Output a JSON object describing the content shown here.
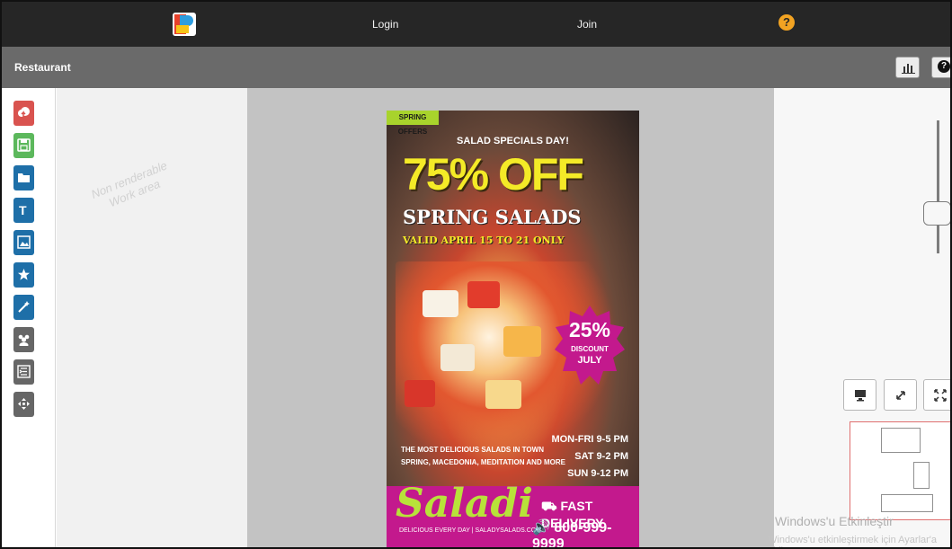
{
  "topbar": {
    "nav": [
      "Login",
      "Join"
    ],
    "help_icon": "?"
  },
  "titlebar": {
    "title": "Restaurant",
    "help_label": "?"
  },
  "lefttools": [
    {
      "name": "upload-icon",
      "color": "#d9534f"
    },
    {
      "name": "save-icon",
      "color": "#5cb85c"
    },
    {
      "name": "folder-open-icon",
      "color": "#1e6fa8"
    },
    {
      "name": "text-icon",
      "color": "#1e6fa8"
    },
    {
      "name": "image-icon",
      "color": "#1e6fa8"
    },
    {
      "name": "star-icon",
      "color": "#1e6fa8"
    },
    {
      "name": "magic-wand-icon",
      "color": "#1e6fa8"
    },
    {
      "name": "group-icon",
      "color": "#666666"
    },
    {
      "name": "layers-icon",
      "color": "#666666"
    },
    {
      "name": "move-icon",
      "color": "#666666"
    }
  ],
  "workarea": {
    "watermark_line1": "Non renderable",
    "watermark_line2": "Work area"
  },
  "poster": {
    "tag": "SPRING OFFERS",
    "specials": "SALAD SPECIALS DAY!",
    "headline": "75% OFF",
    "subheadline": "SPRING SALADS",
    "valid": "VALID APRIL 15 TO 21 ONLY",
    "badge": {
      "percent": "25%",
      "label": "DISCOUNT",
      "month": "JULY"
    },
    "hours": [
      "MON-FRI 9-5 PM",
      "SAT 9-2 PM",
      "SUN 9-12 PM"
    ],
    "description": [
      "THE MOST DELICIOUS SALADS IN TOWN",
      "SPRING, MACEDONIA, MEDITATION AND MORE"
    ],
    "brand": "Saladi",
    "brand_tagline": "DELICIOUS EVERY DAY | SALADYSALADS.COM",
    "delivery": "FAST DELIVERY",
    "phone": "800-999-9999",
    "colors": {
      "accent": "#f4ea27",
      "magenta": "#c3198d",
      "green": "#a8d32c"
    }
  },
  "right": {
    "view_buttons": [
      "monitor-icon",
      "expand-icon",
      "fullscreen-icon"
    ],
    "activation": "Windows'u Etkinleştir",
    "activation_sub": "Windows'u etkinleştirmek için Ayarlar'a gidin."
  }
}
